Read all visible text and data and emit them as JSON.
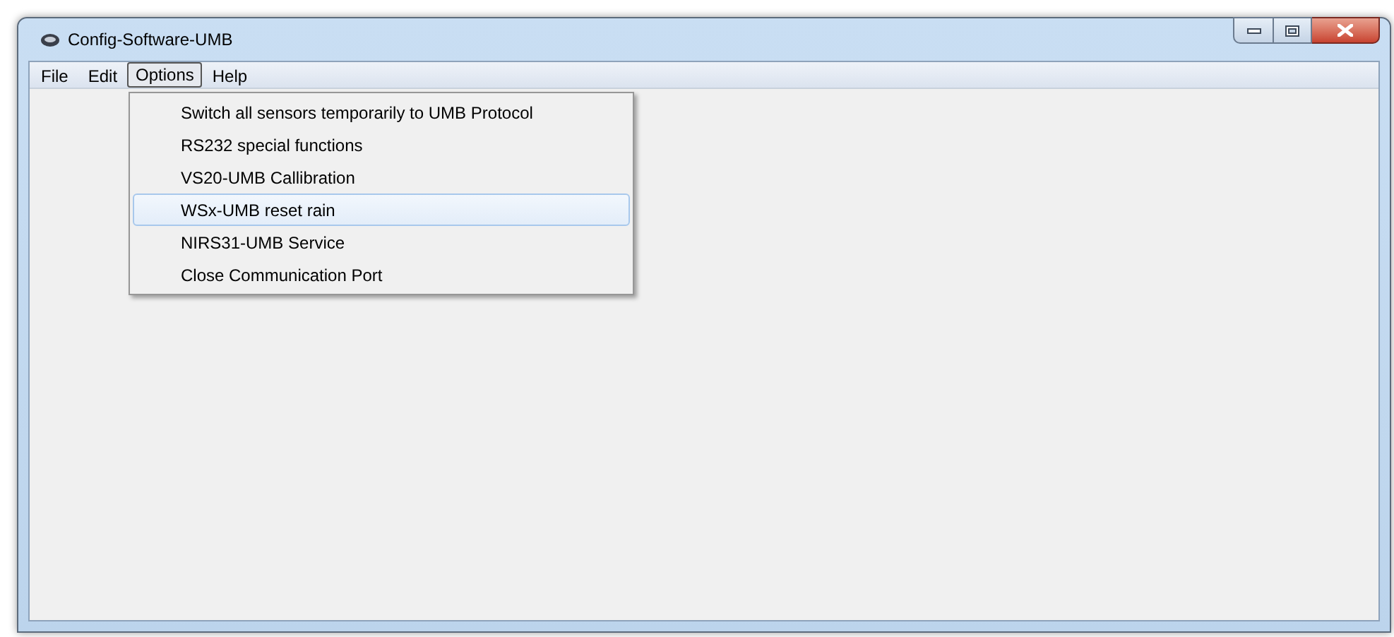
{
  "window": {
    "title": "Config-Software-UMB"
  },
  "menu_bar": [
    {
      "label": "File",
      "selected": false
    },
    {
      "label": "Edit",
      "selected": false
    },
    {
      "label": "Options",
      "selected": true
    },
    {
      "label": "Help",
      "selected": false
    }
  ],
  "dropdown": [
    {
      "label": "Switch all sensors temporarily to UMB Protocol",
      "selected": false
    },
    {
      "label": "RS232 special functions",
      "selected": false
    },
    {
      "label": "VS20-UMB Callibration",
      "selected": false
    },
    {
      "label": "WSx-UMB reset rain",
      "selected": true
    },
    {
      "label": "NIRS31-UMB Service",
      "selected": false
    },
    {
      "label": "Close Communication Port",
      "selected": false
    }
  ]
}
